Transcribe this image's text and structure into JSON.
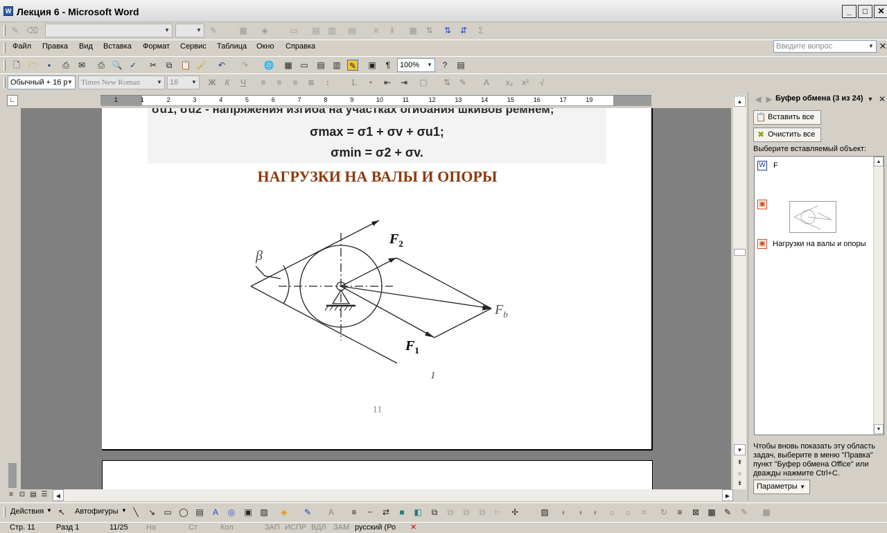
{
  "window": {
    "title": "Лекция 6 - Microsoft Word",
    "icon": "word-doc-icon"
  },
  "menu": {
    "items": [
      "Файл",
      "Правка",
      "Вид",
      "Вставка",
      "Формат",
      "Сервис",
      "Таблица",
      "Окно",
      "Справка"
    ],
    "question_placeholder": "Введите вопрос"
  },
  "standard_toolbar": {
    "zoom": "100%"
  },
  "formatting_toolbar": {
    "style": "Обычный + 16 р",
    "font": "Times New Roman",
    "size": "16"
  },
  "ruler": {
    "numbers": [
      "1",
      "1",
      "2",
      "3",
      "4",
      "5",
      "6",
      "7",
      "8",
      "9",
      "10",
      "11",
      "12",
      "13",
      "14",
      "15",
      "16",
      "17",
      "19"
    ]
  },
  "document": {
    "top_text": "σu1, σu2 - напряжения изгиба на участках огибания шкивов ремнем;",
    "formula1": "σmax = σ1 + σv + σu1;",
    "formula2": "σmin = σ2 + σv.",
    "heading": "НАГРУЗКИ НА ВАЛЫ И ОПОРЫ",
    "label_beta": "β",
    "label_f2": "F",
    "label_f2_sub": "2",
    "label_f1": "F",
    "label_f1_sub": "1",
    "label_fb": "F",
    "label_fb_sub": "b",
    "label_one": "1",
    "page_number": "11",
    "heading_color": "#8b3a0e"
  },
  "taskpane": {
    "title": "Буфер обмена (3 из 24)",
    "paste_all": "Вставить все",
    "clear_all": "Очистить все",
    "choose_label": "Выберите вставляемый объект:",
    "items": [
      {
        "icon": "word-doc-icon",
        "text": "F"
      },
      {
        "icon": "picture-clip-icon",
        "text": ""
      },
      {
        "icon": "picture-clip-icon",
        "text": "Нагрузки на валы и опоры"
      }
    ],
    "hint": "Чтобы вновь показать эту область задач, выберите в меню \"Правка\" пункт \"Буфер обмена Office\" или дважды нажмите Ctrl+C.",
    "options": "Параметры"
  },
  "drawing_toolbar": {
    "actions": "Действия",
    "autoshapes": "Автофигуры"
  },
  "status": {
    "page": "Стр. 11",
    "section": "Разд 1",
    "pages": "11/25",
    "at": "На",
    "line": "Ст",
    "col": "Кол",
    "rec": "ЗАП",
    "trk": "ИСПР",
    "ext": "ВДЛ",
    "ovr": "ЗАМ",
    "lang": "русский (Ро"
  }
}
